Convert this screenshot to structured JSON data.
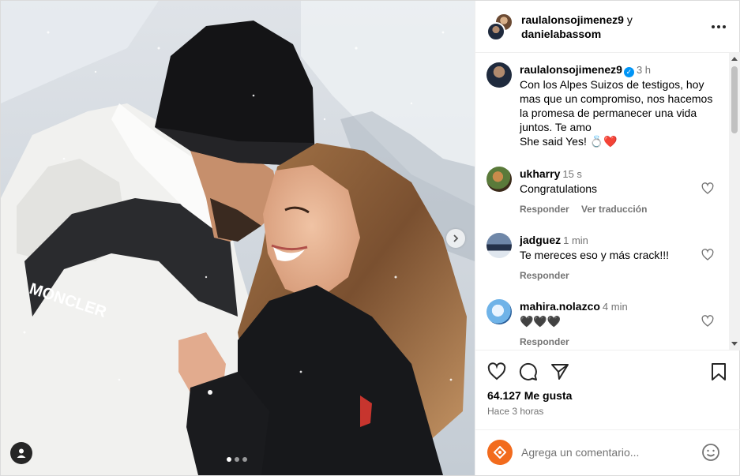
{
  "header": {
    "user1": "raulalonsojimenez9",
    "joiner": "y",
    "user2": "danielabassom"
  },
  "caption": {
    "username": "raulalonsojimenez9",
    "time": "3 h",
    "lines": [
      "Con los Alpes Suizos de testigos, hoy",
      "mas que un compromiso, nos hacemos",
      "la promesa de permanecer una vida",
      "juntos. Te amo",
      "She said Yes! 💍❤️"
    ]
  },
  "comments": [
    {
      "username": "ukharry",
      "time": "15 s",
      "text": "Congratulations",
      "reply": "Responder",
      "translate": "Ver traducción"
    },
    {
      "username": "jadguez",
      "time": "1 min",
      "text": "Te mereces eso y más crack!!!",
      "reply": "Responder"
    },
    {
      "username": "mahira.nolazco",
      "time": "4 min",
      "text": "🖤🖤🖤",
      "reply": "Responder"
    }
  ],
  "footer": {
    "likes": "64.127 Me gusta",
    "posted": "Hace 3 horas",
    "comment_placeholder": "Agrega un comentario..."
  },
  "photo": {
    "jacket_brand": "MONCLER"
  },
  "colors": {
    "accent_blue": "#0095f6",
    "muted_text": "#737373",
    "border": "#efefef"
  }
}
